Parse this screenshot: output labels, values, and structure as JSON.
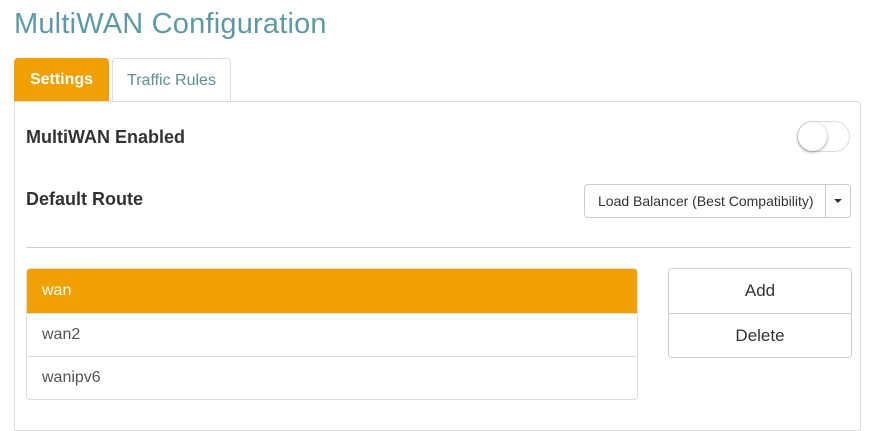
{
  "page": {
    "title": "MultiWAN Configuration"
  },
  "tabs": [
    {
      "label": "Settings",
      "active": true
    },
    {
      "label": "Traffic Rules",
      "active": false
    }
  ],
  "settings": {
    "enabled_label": "MultiWAN Enabled",
    "enabled": false,
    "route_label": "Default Route",
    "route_value": "Load Balancer (Best Compatibility)"
  },
  "wan_list": [
    {
      "name": "wan",
      "selected": true
    },
    {
      "name": "wan2",
      "selected": false
    },
    {
      "name": "wanipv6",
      "selected": false
    }
  ],
  "actions": {
    "add_label": "Add",
    "delete_label": "Delete"
  },
  "colors": {
    "accent": "#f0a000",
    "title": "#5d9aa3",
    "tab_text": "#5d8f97"
  }
}
